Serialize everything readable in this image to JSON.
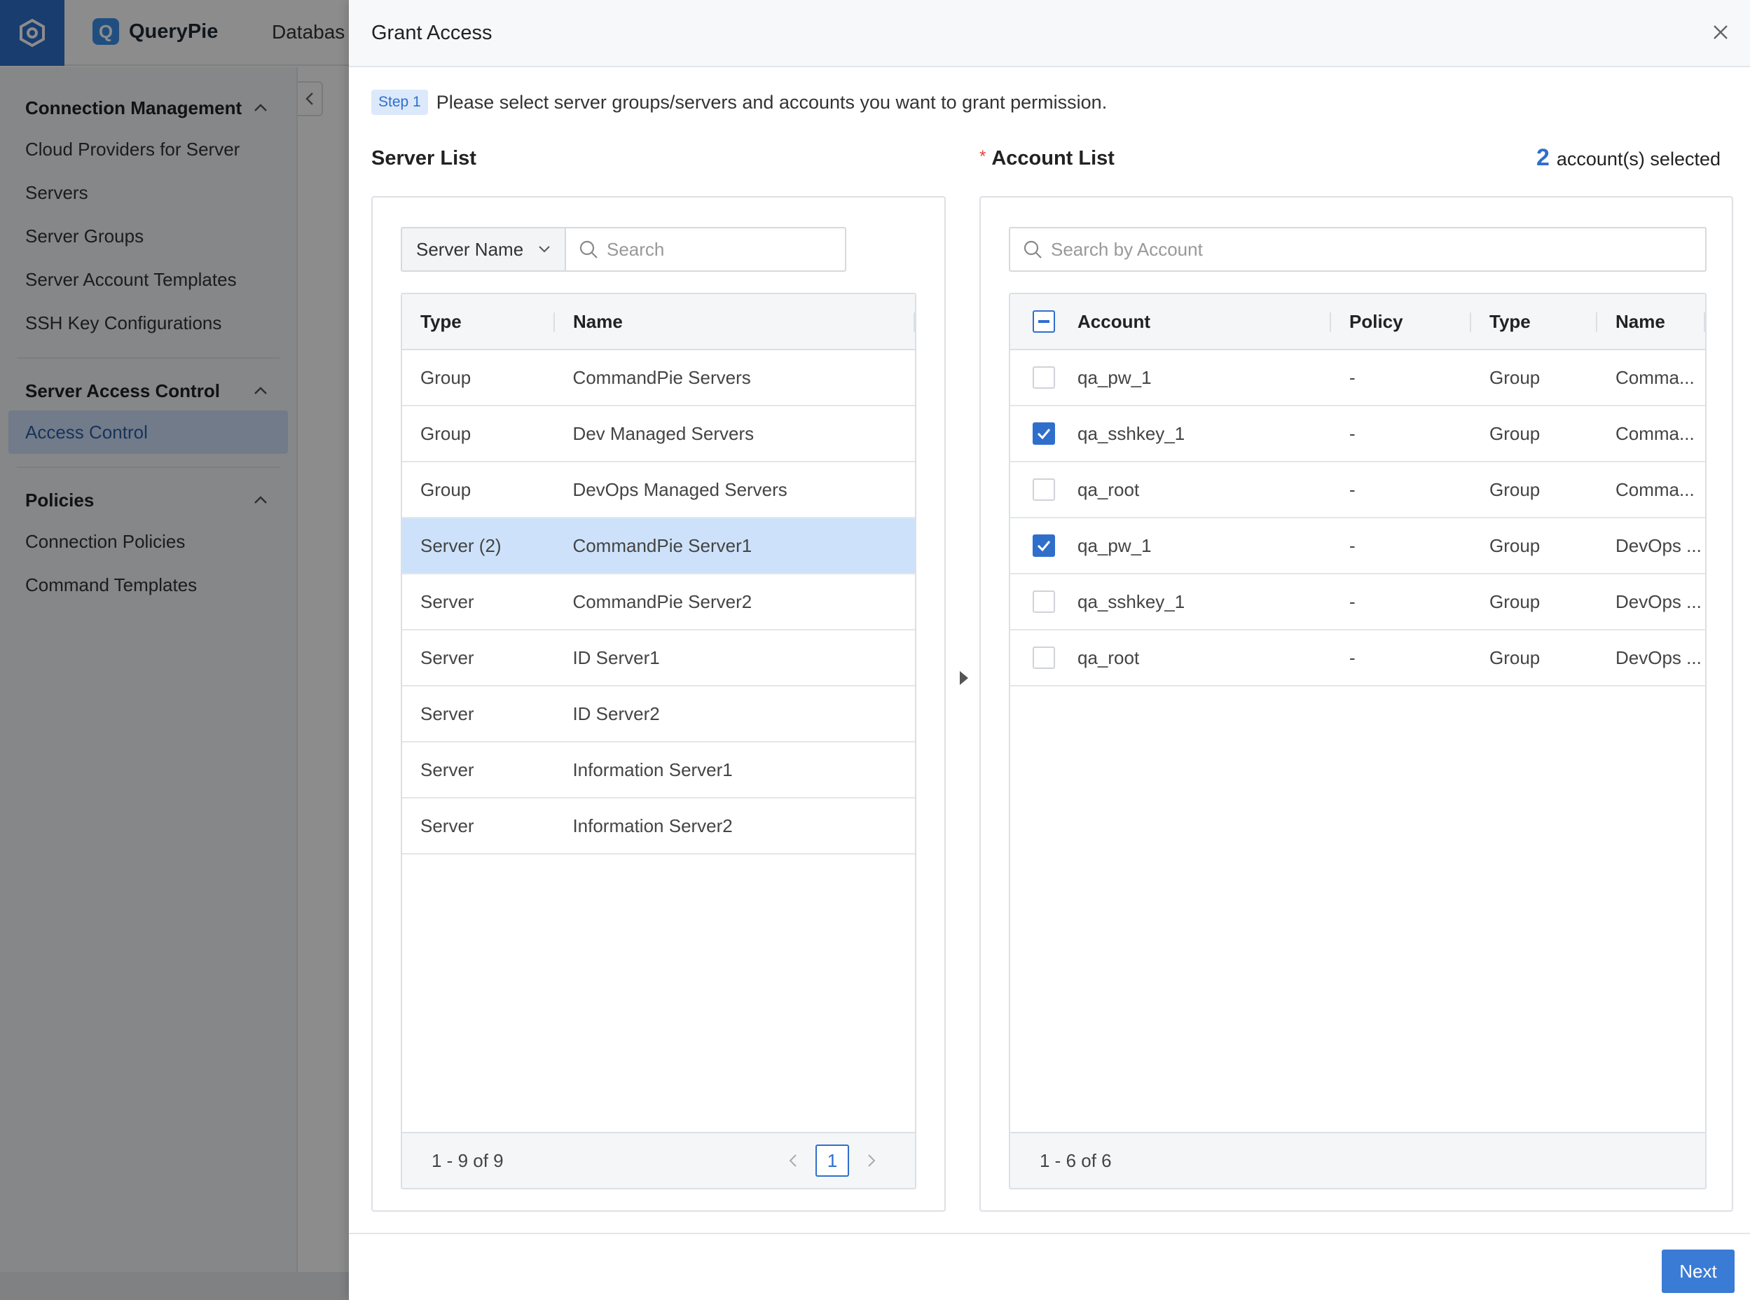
{
  "app": {
    "brand": "QueryPie",
    "top_nav_item": "Databas"
  },
  "sidebar": {
    "sections": [
      {
        "title": "Connection Management",
        "items": [
          "Cloud Providers for Server",
          "Servers",
          "Server Groups",
          "Server Account Templates",
          "SSH Key Configurations"
        ]
      },
      {
        "title": "Server Access Control",
        "items": [
          "Access Control"
        ],
        "active": "Access Control"
      },
      {
        "title": "Policies",
        "items": [
          "Connection Policies",
          "Command Templates"
        ]
      }
    ]
  },
  "modal": {
    "title": "Grant Access",
    "step_badge": "Step 1",
    "step_text": "Please select server groups/servers and accounts you want to grant permission.",
    "server_list": {
      "title": "Server List",
      "filter_dropdown": "Server Name",
      "search_placeholder": "Search",
      "columns": [
        "Type",
        "Name"
      ],
      "rows": [
        {
          "type": "Group",
          "name": "CommandPie Servers",
          "selected": false
        },
        {
          "type": "Group",
          "name": "Dev Managed Servers",
          "selected": false
        },
        {
          "type": "Group",
          "name": "DevOps Managed Servers",
          "selected": false
        },
        {
          "type": "Server (2)",
          "name": "CommandPie Server1",
          "selected": true
        },
        {
          "type": "Server",
          "name": "CommandPie Server2",
          "selected": false
        },
        {
          "type": "Server",
          "name": "ID Server1",
          "selected": false
        },
        {
          "type": "Server",
          "name": "ID Server2",
          "selected": false
        },
        {
          "type": "Server",
          "name": "Information Server1",
          "selected": false
        },
        {
          "type": "Server",
          "name": "Information Server2",
          "selected": false
        }
      ],
      "footer": "1 - 9 of 9",
      "current_page": "1"
    },
    "account_list": {
      "title": "Account List",
      "required_mark": "*",
      "selected_count": "2",
      "selected_suffix": "account(s) selected",
      "search_placeholder": "Search by Account",
      "columns": [
        "Account",
        "Policy",
        "Type",
        "Name"
      ],
      "rows": [
        {
          "account": "qa_pw_1",
          "policy": "-",
          "type": "Group",
          "name": "Comma...",
          "checked": false
        },
        {
          "account": "qa_sshkey_1",
          "policy": "-",
          "type": "Group",
          "name": "Comma...",
          "checked": true
        },
        {
          "account": "qa_root",
          "policy": "-",
          "type": "Group",
          "name": "Comma...",
          "checked": false
        },
        {
          "account": "qa_pw_1",
          "policy": "-",
          "type": "Group",
          "name": "DevOps ...",
          "checked": true
        },
        {
          "account": "qa_sshkey_1",
          "policy": "-",
          "type": "Group",
          "name": "DevOps ...",
          "checked": false
        },
        {
          "account": "qa_root",
          "policy": "-",
          "type": "Group",
          "name": "DevOps ...",
          "checked": false
        }
      ],
      "footer": "1 - 6 of 6"
    },
    "next_label": "Next"
  },
  "colors": {
    "accent": "#2f6fcb",
    "selected_row": "#cde2fa",
    "required": "#e0463c"
  }
}
